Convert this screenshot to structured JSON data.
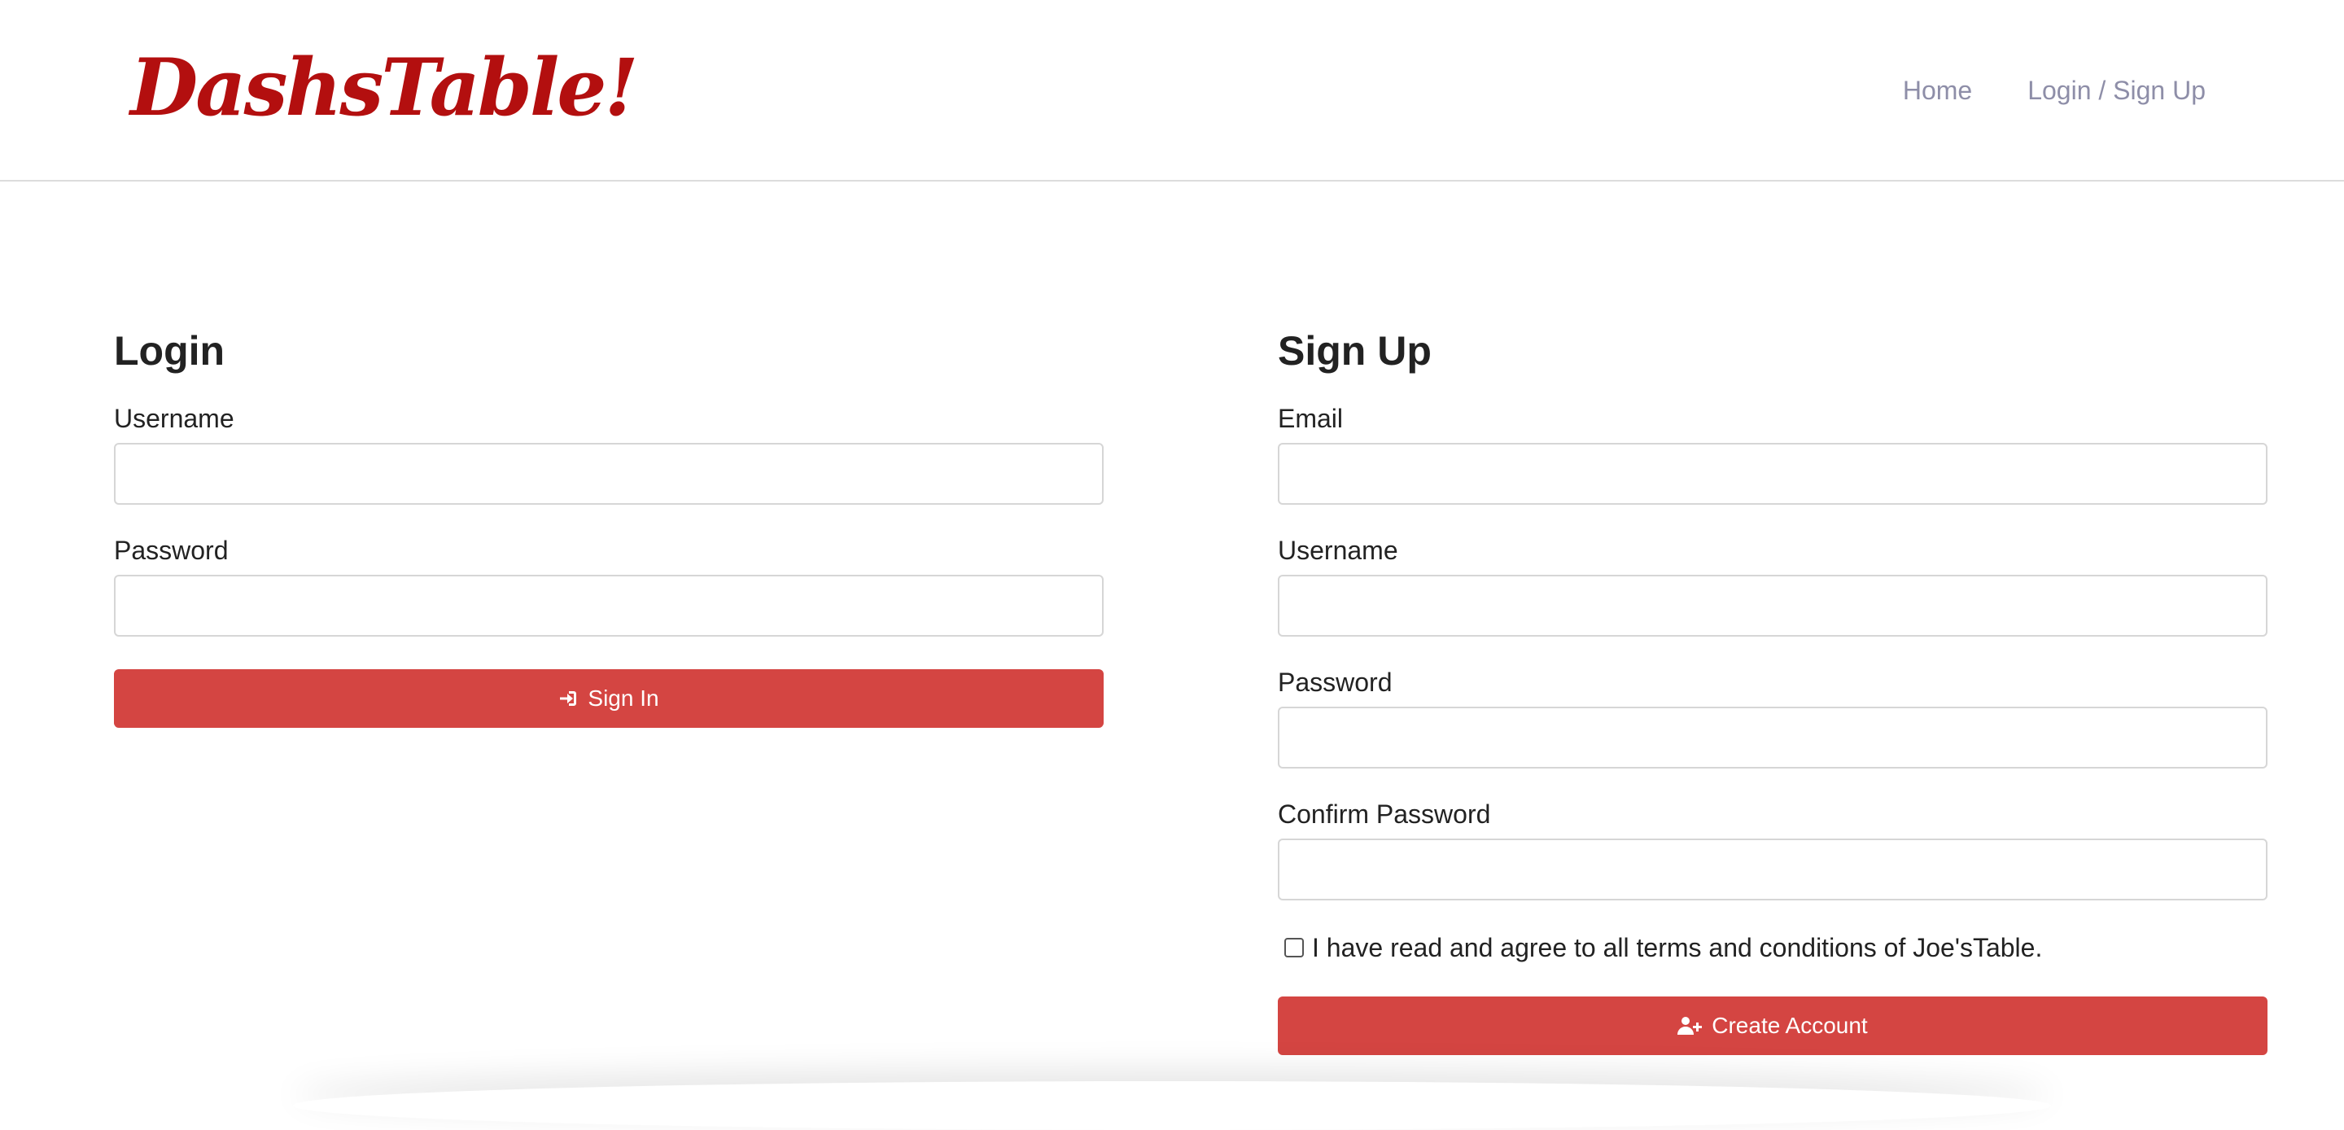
{
  "brand": {
    "logo_text": "DashsTable!",
    "color": "#b30f0f"
  },
  "nav": {
    "items": [
      {
        "label": "Home"
      },
      {
        "label": "Login / Sign Up"
      }
    ]
  },
  "login": {
    "title": "Login",
    "fields": [
      {
        "label": "Username",
        "value": "",
        "placeholder": ""
      },
      {
        "label": "Password",
        "value": "",
        "placeholder": ""
      }
    ],
    "submit": {
      "label": "Sign In",
      "icon": "sign-in-icon"
    }
  },
  "signup": {
    "title": "Sign Up",
    "fields": [
      {
        "label": "Email",
        "value": "",
        "placeholder": ""
      },
      {
        "label": "Username",
        "value": "",
        "placeholder": ""
      },
      {
        "label": "Password",
        "value": "",
        "placeholder": ""
      },
      {
        "label": "Confirm Password",
        "value": "",
        "placeholder": ""
      }
    ],
    "terms": {
      "label": "I have read and agree to all terms and conditions of Joe'sTable.",
      "checked": false
    },
    "submit": {
      "label": "Create Account",
      "icon": "user-plus-icon"
    }
  },
  "colors": {
    "accent": "#d44542",
    "nav_text": "#8e8ea8"
  }
}
